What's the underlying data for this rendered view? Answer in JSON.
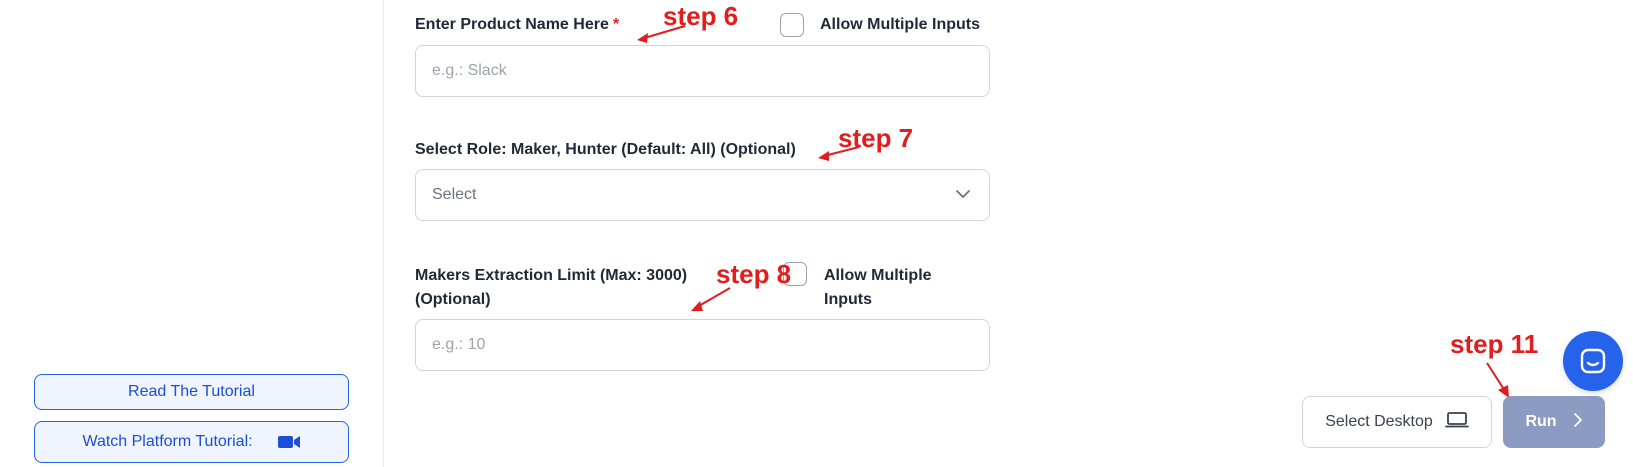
{
  "sidebar": {
    "read_tutorial": "Read The Tutorial",
    "watch_tutorial": "Watch Platform Tutorial:"
  },
  "form": {
    "product_name": {
      "label": "Enter Product Name Here",
      "required_mark": "*",
      "placeholder": "e.g.: Slack",
      "allow_multiple_label": "Allow Multiple Inputs"
    },
    "role": {
      "label": "Select Role: Maker, Hunter (Default: All) (Optional)",
      "placeholder": "Select"
    },
    "limit": {
      "label_line1": "Makers Extraction Limit (Max: 3000)",
      "label_line2": "(Optional)",
      "placeholder": "e.g.: 10",
      "allow_multiple_line1": "Allow Multiple",
      "allow_multiple_line2": "Inputs"
    }
  },
  "annotations": {
    "step6": "step 6",
    "step7": "step 7",
    "step8": "step 8",
    "step11": "step 11"
  },
  "footer": {
    "select_desktop": "Select Desktop",
    "run": "Run"
  },
  "colors": {
    "accent": "#2563eb",
    "annotation": "#e11d1d",
    "run_button": "#8c9bc2"
  },
  "icons": [
    "video-camera-icon",
    "chevron-down-icon",
    "laptop-icon",
    "chevron-right-icon",
    "chat-icon"
  ]
}
